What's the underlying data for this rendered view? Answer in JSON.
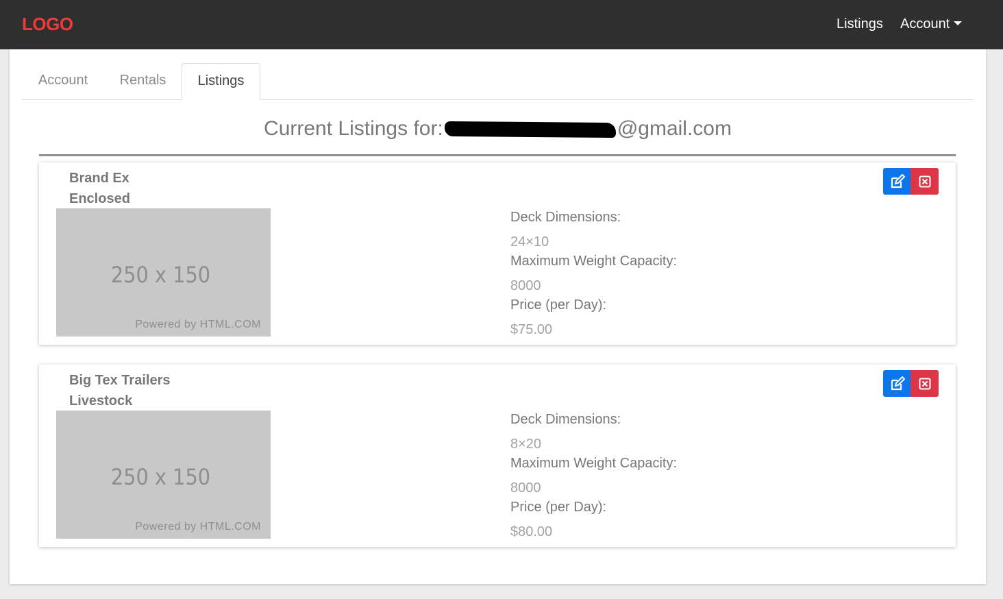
{
  "navbar": {
    "logo": "LOGO",
    "links": {
      "listings": "Listings",
      "account": "Account"
    }
  },
  "tabs": [
    "Account",
    "Rentals",
    "Listings"
  ],
  "active_tab": "Listings",
  "heading": {
    "prefix": "Current Listings for:",
    "email_suffix": "@gmail.com"
  },
  "spec_labels": {
    "deck": "Deck Dimensions:",
    "weight": "Maximum Weight Capacity:",
    "price": "Price (per Day):"
  },
  "listings": [
    {
      "brand": "Brand Ex",
      "type": "Enclosed",
      "image_size_text": "250 x 150",
      "image_powered_text": "Powered by HTML.COM",
      "deck": "24×10",
      "weight": "8000",
      "price": "$75.00"
    },
    {
      "brand": "Big Tex Trailers",
      "type": "Livestock",
      "image_size_text": "250 x 150",
      "image_powered_text": "Powered by HTML.COM",
      "deck": "8×20",
      "weight": "8000",
      "price": "$80.00"
    }
  ],
  "colors": {
    "navbar_bg": "#2f2f2f",
    "logo": "#ef3a3a",
    "edit_button": "#0d76eb",
    "delete_button": "#dc3545"
  },
  "icons": {
    "edit": "edit-icon",
    "delete": "close-icon",
    "dropdown": "caret-down-icon"
  }
}
